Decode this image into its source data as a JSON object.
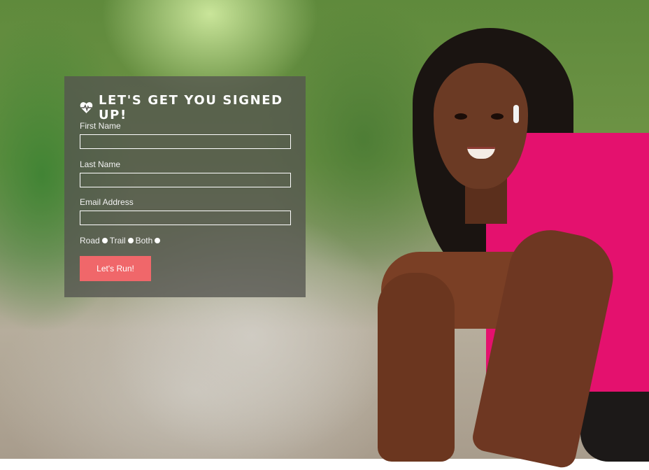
{
  "form": {
    "title": "LET'S GET YOU SIGNED UP!",
    "icon": "heartbeat-icon",
    "fields": [
      {
        "label": "First Name",
        "value": "",
        "placeholder": ""
      },
      {
        "label": "Last Name",
        "value": "",
        "placeholder": ""
      },
      {
        "label": "Email Address",
        "value": "",
        "placeholder": ""
      }
    ],
    "run_types": [
      "Road",
      "Trail",
      "Both"
    ],
    "submit_label": "Let's Run!"
  },
  "colors": {
    "button": "#f0676a",
    "panel": "rgba(85,85,80,0.78)",
    "shirt": "#e4116e"
  }
}
